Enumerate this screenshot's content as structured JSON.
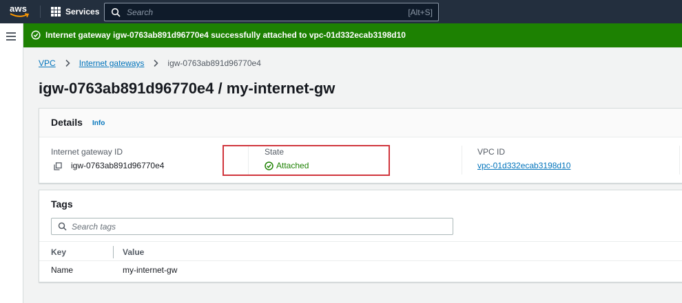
{
  "topnav": {
    "logo_text": "aws",
    "services_label": "Services",
    "search_placeholder": "Search",
    "search_shortcut": "[Alt+S]"
  },
  "flash": {
    "message": "Internet gateway igw-0763ab891d96770e4 successfully attached to vpc-01d332ecab3198d10",
    "color": "#1d8102"
  },
  "breadcrumb": {
    "items": [
      "VPC",
      "Internet gateways"
    ],
    "current": "igw-0763ab891d96770e4"
  },
  "page": {
    "title": "igw-0763ab891d96770e4 / my-internet-gw"
  },
  "details": {
    "title": "Details",
    "info_label": "Info",
    "gateway_id_label": "Internet gateway ID",
    "gateway_id_value": "igw-0763ab891d96770e4",
    "state_label": "State",
    "state_value": "Attached",
    "vpc_id_label": "VPC ID",
    "vpc_id_value": "vpc-01d332ecab3198d10"
  },
  "tags": {
    "title": "Tags",
    "search_placeholder": "Search tags",
    "columns": [
      "Key",
      "Value"
    ],
    "rows": [
      {
        "key": "Name",
        "value": "my-internet-gw"
      }
    ]
  },
  "colors": {
    "nav_bg": "#232f3e",
    "success": "#1d8102",
    "link": "#0073bb",
    "highlight": "#d0343b"
  }
}
